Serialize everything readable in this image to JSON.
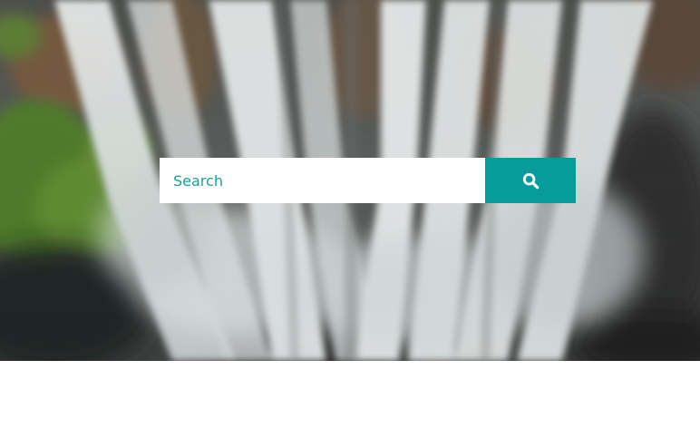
{
  "hero": {
    "image": "waterfall-aerial-photo"
  },
  "search": {
    "placeholder": "Search",
    "value": "",
    "button_icon": "search-icon"
  },
  "colors": {
    "accent": "#079b9b",
    "placeholder_text": "#1f9c9c",
    "page_background": "#ffffff"
  }
}
